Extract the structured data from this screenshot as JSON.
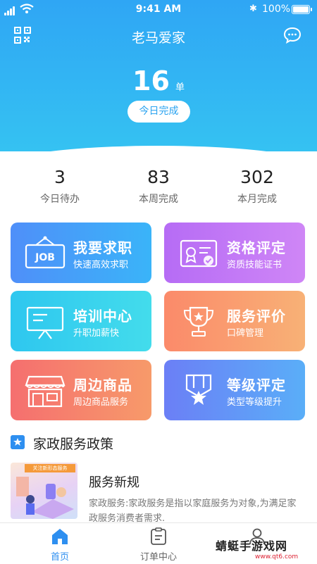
{
  "status_bar": {
    "time": "9:41 AM",
    "battery": "100%"
  },
  "header": {
    "title": "老马爱家"
  },
  "summary": {
    "count": "16",
    "unit": "单",
    "today_button": "今日完成"
  },
  "stats": [
    {
      "value": "3",
      "label": "今日待办"
    },
    {
      "value": "83",
      "label": "本周完成"
    },
    {
      "value": "302",
      "label": "本月完成"
    }
  ],
  "cards": [
    {
      "title": "我要求职",
      "subtitle": "快速高效求职",
      "icon": "job-sign-icon",
      "icon_text": "JOB"
    },
    {
      "title": "资格评定",
      "subtitle": "资质技能证书",
      "icon": "certificate-icon"
    },
    {
      "title": "培训中心",
      "subtitle": "升职加薪快",
      "icon": "training-board-icon"
    },
    {
      "title": "服务评价",
      "subtitle": "口碑管理",
      "icon": "trophy-icon"
    },
    {
      "title": "周边商品",
      "subtitle": "周边商品服务",
      "icon": "shop-icon"
    },
    {
      "title": "等级评定",
      "subtitle": "类型等级提升",
      "icon": "rank-badge-icon"
    }
  ],
  "section": {
    "title": "家政服务政策"
  },
  "news": {
    "thumb_tag": "关注新形态服务",
    "title": "服务新规",
    "description": "家政服务:家政服务是指以家庭服务为对象,为满足家政服务消费者需求."
  },
  "tabbar": {
    "tabs": [
      {
        "label": "首页"
      },
      {
        "label": "订单中心"
      },
      {
        "label": ""
      }
    ]
  },
  "watermark": {
    "text": "蜻蜓手游戏网",
    "url": "www.qt6.com"
  }
}
